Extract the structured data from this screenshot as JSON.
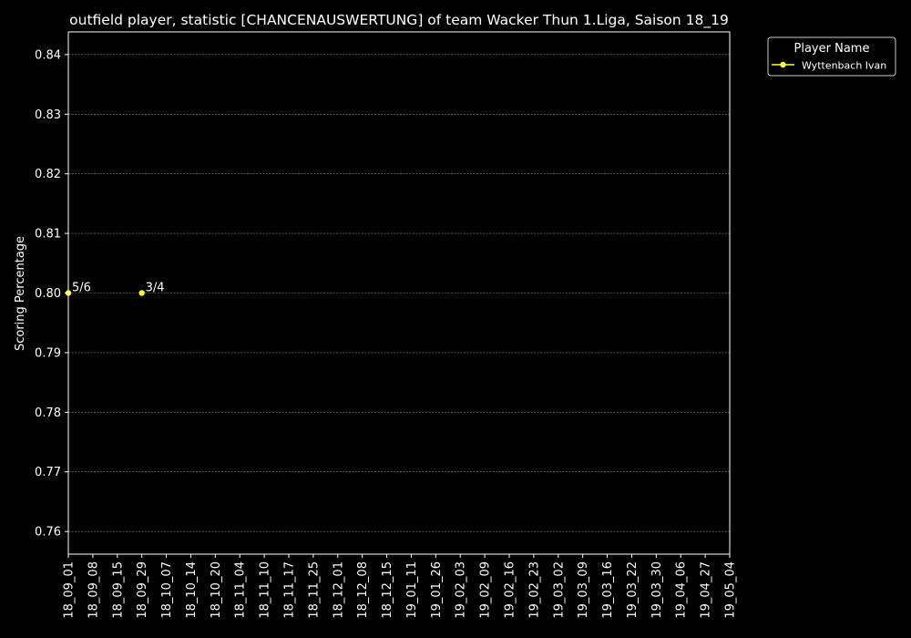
{
  "chart_data": {
    "type": "line",
    "title": "outfield player, statistic [CHANCENAUSWERTUNG] of team Wacker Thun 1.Liga, Saison 18_19",
    "xlabel": "",
    "ylabel": "Scoring Percentage",
    "ylim": [
      0.7562,
      0.8438
    ],
    "yticks": [
      "0.76",
      "0.77",
      "0.78",
      "0.79",
      "0.80",
      "0.81",
      "0.82",
      "0.83",
      "0.84"
    ],
    "categories": [
      "18_09_01",
      "18_09_08",
      "18_09_15",
      "18_09_29",
      "18_10_07",
      "18_10_14",
      "18_10_20",
      "18_11_04",
      "18_11_10",
      "18_11_17",
      "18_11_25",
      "18_12_01",
      "18_12_08",
      "18_12_15",
      "19_01_11",
      "19_01_26",
      "19_02_03",
      "19_02_09",
      "19_02_16",
      "19_02_23",
      "19_03_02",
      "19_03_09",
      "19_03_16",
      "19_03_22",
      "19_03_30",
      "19_04_06",
      "19_04_27",
      "19_05_04"
    ],
    "grid": true,
    "legend": {
      "title": "Player Name",
      "placement": "outside top-right"
    },
    "series": [
      {
        "name": "Wyttenbach Ivan",
        "color": "#ffff33",
        "points": [
          {
            "x": "18_09_01",
            "y": 0.8,
            "label": "5/6"
          },
          {
            "x": "18_09_29",
            "y": 0.8,
            "label": "3/4"
          }
        ]
      }
    ]
  }
}
